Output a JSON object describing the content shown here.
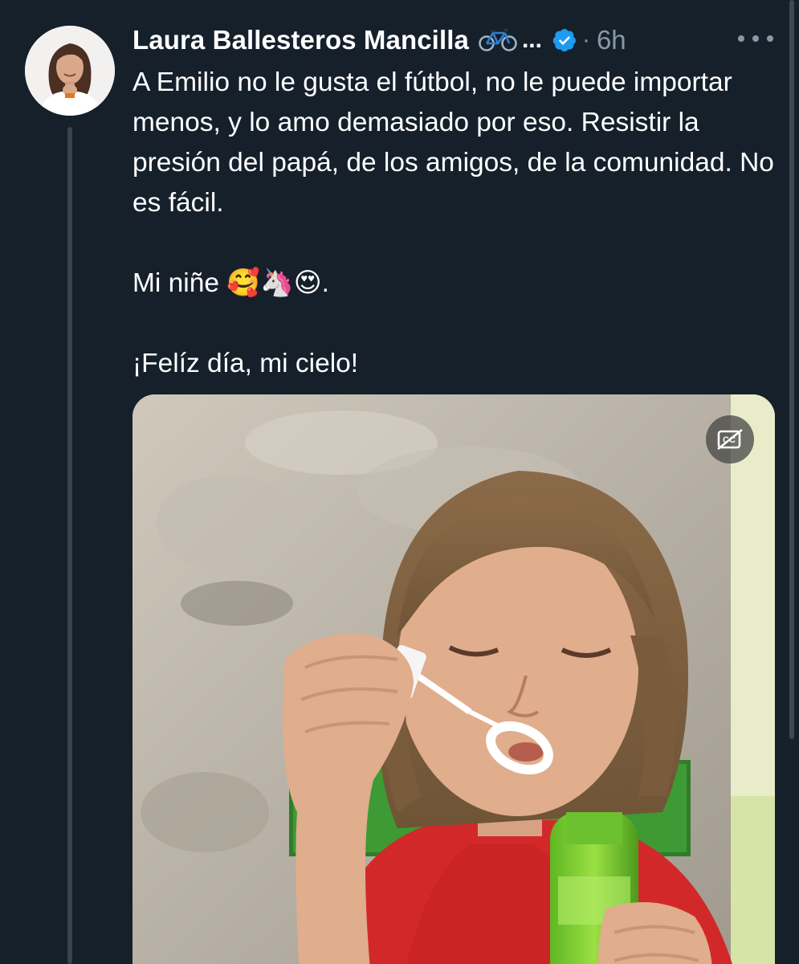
{
  "tweet": {
    "author_name": "Laura Ballesteros Mancilla",
    "name_emoji": "bicycle",
    "truncation": "...",
    "verified_icon": "verified-badge-icon",
    "separator": "·",
    "timestamp": "6h",
    "paragraphs": [
      "A Emilio no le gusta el fútbol, no le puede importar menos, y lo amo demasiado por eso. Resistir la presión del papá, de los amigos, de la comunidad. No es fácil.",
      "Mi niñe 🥰🦄😍.",
      "¡Felíz día, mi cielo!"
    ],
    "media_icons": [
      "closed-captions-off-icon"
    ],
    "colors": {
      "background": "#15202b",
      "secondary_text": "#8899a6",
      "verified_blue": "#1d9bf0",
      "thread_line": "#38444d"
    }
  }
}
